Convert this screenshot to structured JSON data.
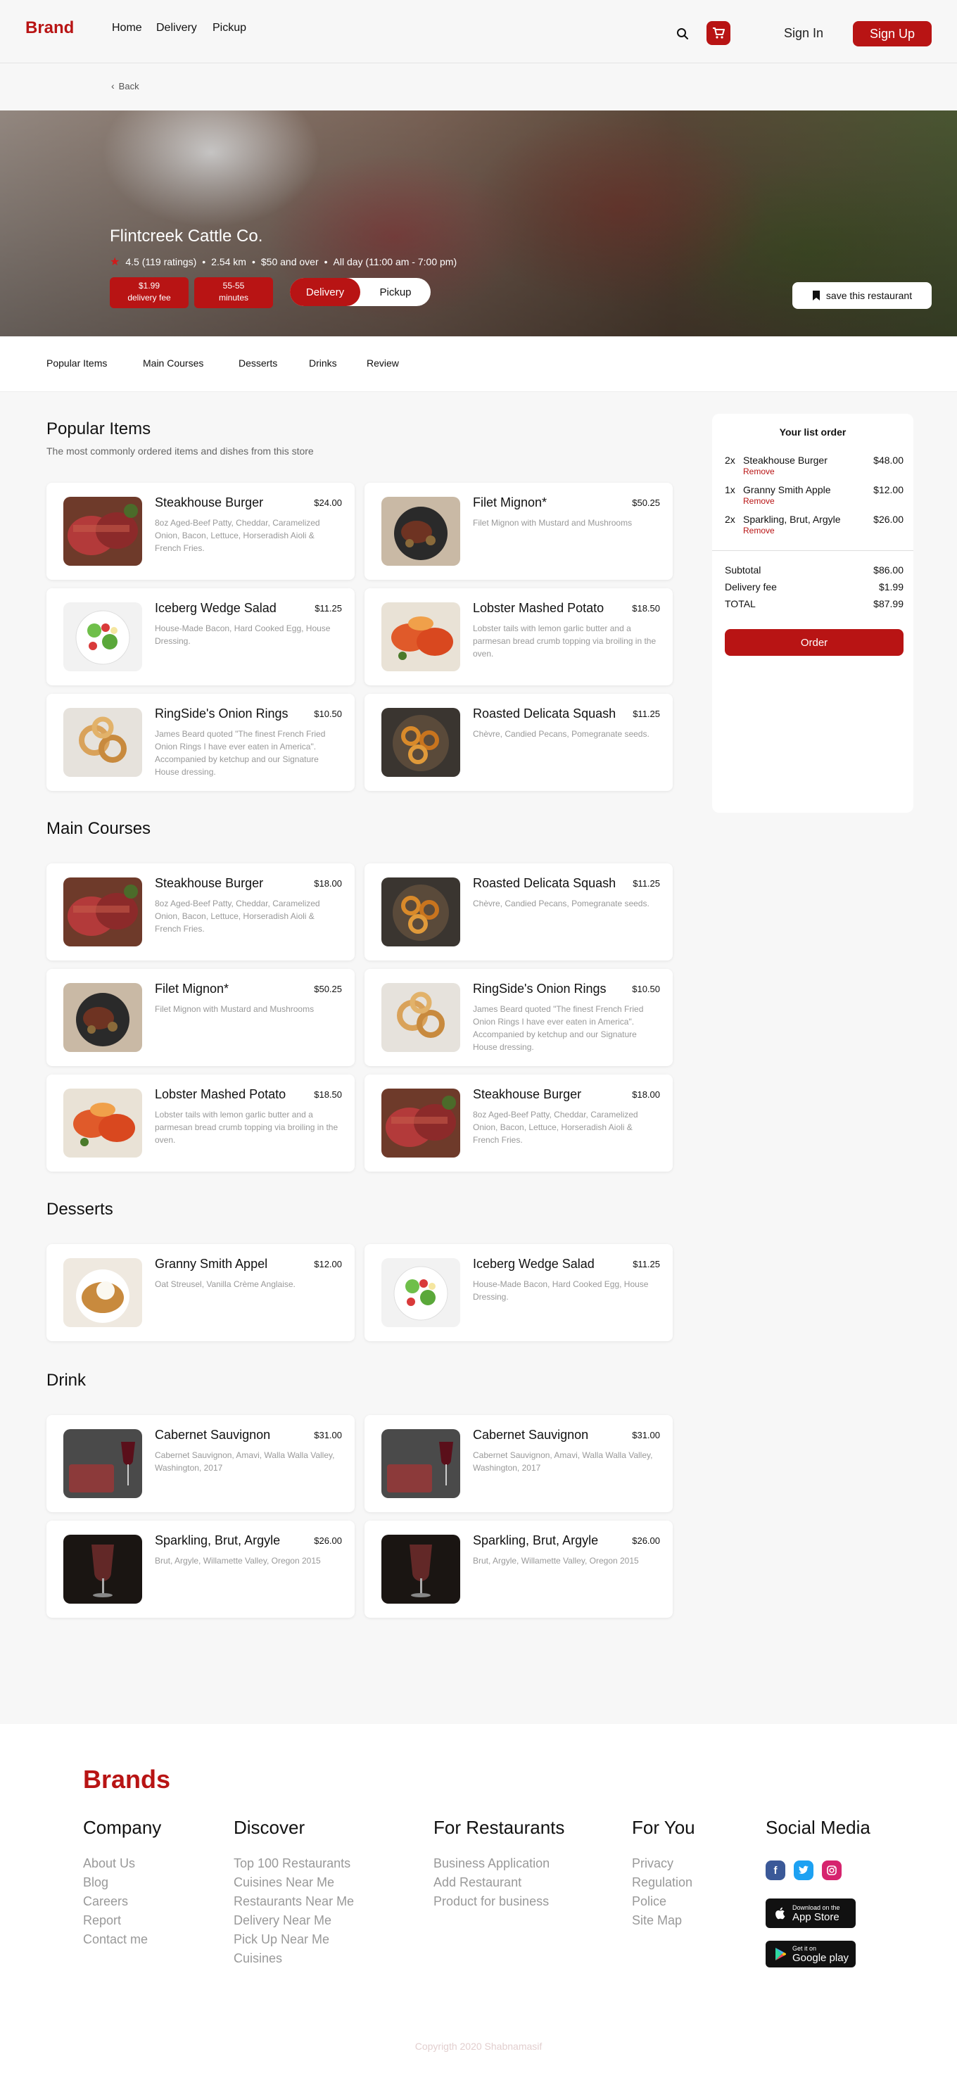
{
  "header": {
    "brand": "Brand",
    "nav": [
      "Home",
      "Delivery",
      "Pickup"
    ],
    "sign_in": "Sign In",
    "sign_up": "Sign Up"
  },
  "back": "Back",
  "restaurant": {
    "name": "Flintcreek Cattle Co.",
    "rating": "4.5 (119 ratings)",
    "distance": "2.54 km",
    "price": "$50 and over",
    "hours": "All day (11:00 am - 7:00 pm)",
    "delivery_fee_line1": "$1.99",
    "delivery_fee_line2": "delivery fee",
    "minutes_line1": "55-55",
    "minutes_line2": "minutes",
    "mode_delivery": "Delivery",
    "mode_pickup": "Pickup",
    "save": "save this restaurant"
  },
  "tabs": [
    "Popular Items",
    "Main Courses",
    "Desserts",
    "Drinks",
    "Review"
  ],
  "sections": {
    "popular": {
      "title": "Popular Items",
      "subtitle": "The most commonly ordered items and dishes from this store",
      "items": [
        {
          "title": "Steakhouse Burger",
          "price": "$24.00",
          "desc": "8oz Aged-Beef Patty, Cheddar, Caramelized Onion, Bacon, Lettuce, Horseradish Aioli & French Fries.",
          "img": "steak"
        },
        {
          "title": "Filet Mignon*",
          "price": "$50.25",
          "desc": "Filet Mignon with Mustard and Mushrooms",
          "img": "skillet"
        },
        {
          "title": "Iceberg Wedge Salad",
          "price": "$11.25",
          "desc": "House-Made Bacon, Hard Cooked Egg, House Dressing.",
          "img": "salad"
        },
        {
          "title": "Lobster Mashed Potato",
          "price": "$18.50",
          "desc": "Lobster tails with lemon garlic butter and a parmesan bread crumb topping via broiling in the oven.",
          "img": "lobster"
        },
        {
          "title": "RingSide's Onion Rings",
          "price": "$10.50",
          "desc": "James Beard quoted \"The finest French Fried Onion Rings I have ever eaten in America\". Accompanied by ketchup and our Signature House dressing.",
          "img": "rings"
        },
        {
          "title": "Roasted Delicata Squash",
          "price": "$11.25",
          "desc": "Chèvre, Candied Pecans, Pomegranate seeds.",
          "img": "squash"
        }
      ]
    },
    "main": {
      "title": "Main Courses",
      "items": [
        {
          "title": "Steakhouse Burger",
          "price": "$18.00",
          "desc": "8oz Aged-Beef Patty, Cheddar, Caramelized Onion, Bacon, Lettuce, Horseradish Aioli & French Fries.",
          "img": "steak"
        },
        {
          "title": "Roasted Delicata Squash",
          "price": "$11.25",
          "desc": "Chèvre, Candied Pecans, Pomegranate seeds.",
          "img": "squash"
        },
        {
          "title": "Filet Mignon*",
          "price": "$50.25",
          "desc": "Filet Mignon with Mustard and Mushrooms",
          "img": "skillet"
        },
        {
          "title": "RingSide's Onion Rings",
          "price": "$10.50",
          "desc": "James Beard quoted \"The finest French Fried Onion Rings I have ever eaten in America\". Accompanied by ketchup and our Signature House dressing.",
          "img": "rings"
        },
        {
          "title": "Lobster Mashed Potato",
          "price": "$18.50",
          "desc": "Lobster tails with lemon garlic butter and a parmesan bread crumb topping via broiling in the oven.",
          "img": "lobster"
        },
        {
          "title": "Steakhouse Burger",
          "price": "$18.00",
          "desc": "8oz Aged-Beef Patty, Cheddar, Caramelized Onion, Bacon, Lettuce, Horseradish Aioli & French Fries.",
          "img": "steak"
        }
      ]
    },
    "desserts": {
      "title": "Desserts",
      "items": [
        {
          "title": "Granny Smith Appel",
          "price": "$12.00",
          "desc": "Oat Streusel, Vanilla Crème Anglaise.",
          "img": "dessert"
        },
        {
          "title": "Iceberg Wedge Salad",
          "price": "$11.25",
          "desc": "House-Made Bacon, Hard Cooked Egg, House Dressing.",
          "img": "salad"
        }
      ]
    },
    "drink": {
      "title": "Drink",
      "items": [
        {
          "title": "Cabernet Sauvignon",
          "price": "$31.00",
          "desc": "Cabernet Sauvignon, Amavi, Walla Walla Valley, Washington, 2017",
          "img": "wine"
        },
        {
          "title": "Cabernet Sauvignon",
          "price": "$31.00",
          "desc": "Cabernet Sauvignon, Amavi, Walla Walla Valley, Washington, 2017",
          "img": "wine"
        },
        {
          "title": "Sparkling, Brut, Argyle",
          "price": "$26.00",
          "desc": "Brut, Argyle, Willamette Valley, Oregon 2015",
          "img": "glass"
        },
        {
          "title": "Sparkling, Brut, Argyle",
          "price": "$26.00",
          "desc": "Brut, Argyle, Willamette Valley, Oregon 2015",
          "img": "glass"
        }
      ]
    }
  },
  "order": {
    "title": "Your list order",
    "items": [
      {
        "qty": "2x",
        "name": "Steakhouse Burger",
        "price": "$48.00",
        "remove": "Remove"
      },
      {
        "qty": "1x",
        "name": "Granny Smith Apple",
        "price": "$12.00",
        "remove": "Remove"
      },
      {
        "qty": "2x",
        "name": "Sparkling, Brut, Argyle",
        "price": "$26.00",
        "remove": "Remove"
      }
    ],
    "subtotal_label": "Subtotal",
    "subtotal": "$86.00",
    "delivery_label": "Delivery fee",
    "delivery": "$1.99",
    "total_label": "TOTAL",
    "total": "$87.99",
    "button": "Order"
  },
  "footer": {
    "brand": "Brands",
    "columns": [
      {
        "title": "Company",
        "links": [
          "About Us",
          "Blog",
          "Careers",
          "Report",
          "Contact me"
        ]
      },
      {
        "title": "Discover",
        "links": [
          "Top 100 Restaurants",
          "Cuisines Near Me",
          "Restaurants Near Me",
          "Delivery Near Me",
          "Pick Up Near Me",
          "Cuisines"
        ]
      },
      {
        "title": "For Restaurants",
        "links": [
          "Business Application",
          "Add Restaurant",
          "Product for business"
        ]
      },
      {
        "title": "For You",
        "links": [
          "Privacy",
          "Regulation",
          "Police",
          "Site Map"
        ]
      }
    ],
    "social_title": "Social Media",
    "app_store_small": "Download on the",
    "app_store_big": "App Store",
    "google_small": "Get it on",
    "google_big": "Google play",
    "copyright": "Copyrigth 2020 Shabnamasif"
  },
  "colors": {
    "accent": "#b81414",
    "background": "#f7f7f7",
    "card": "#ffffff"
  }
}
